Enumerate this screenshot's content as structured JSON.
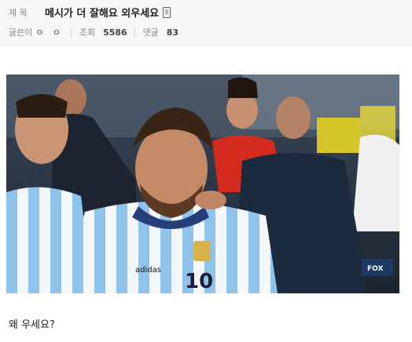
{
  "post": {
    "title_label": "제 목",
    "title": "메시가 더 잘해요 외우세요",
    "author_label": "글쓴이",
    "author": "ㅇ ㅇ",
    "views_label": "조회",
    "views": "5586",
    "comments_label": "댓글",
    "comments": "83",
    "body": "왜 우세요?"
  },
  "colors": {
    "header_bg": "#f7f7f7",
    "jersey_blue": "#75aadb",
    "chile_red": "#d52b1e"
  },
  "photo": {
    "jersey_number": "10",
    "brand": "adidas",
    "broadcaster_logo": "FOX"
  }
}
